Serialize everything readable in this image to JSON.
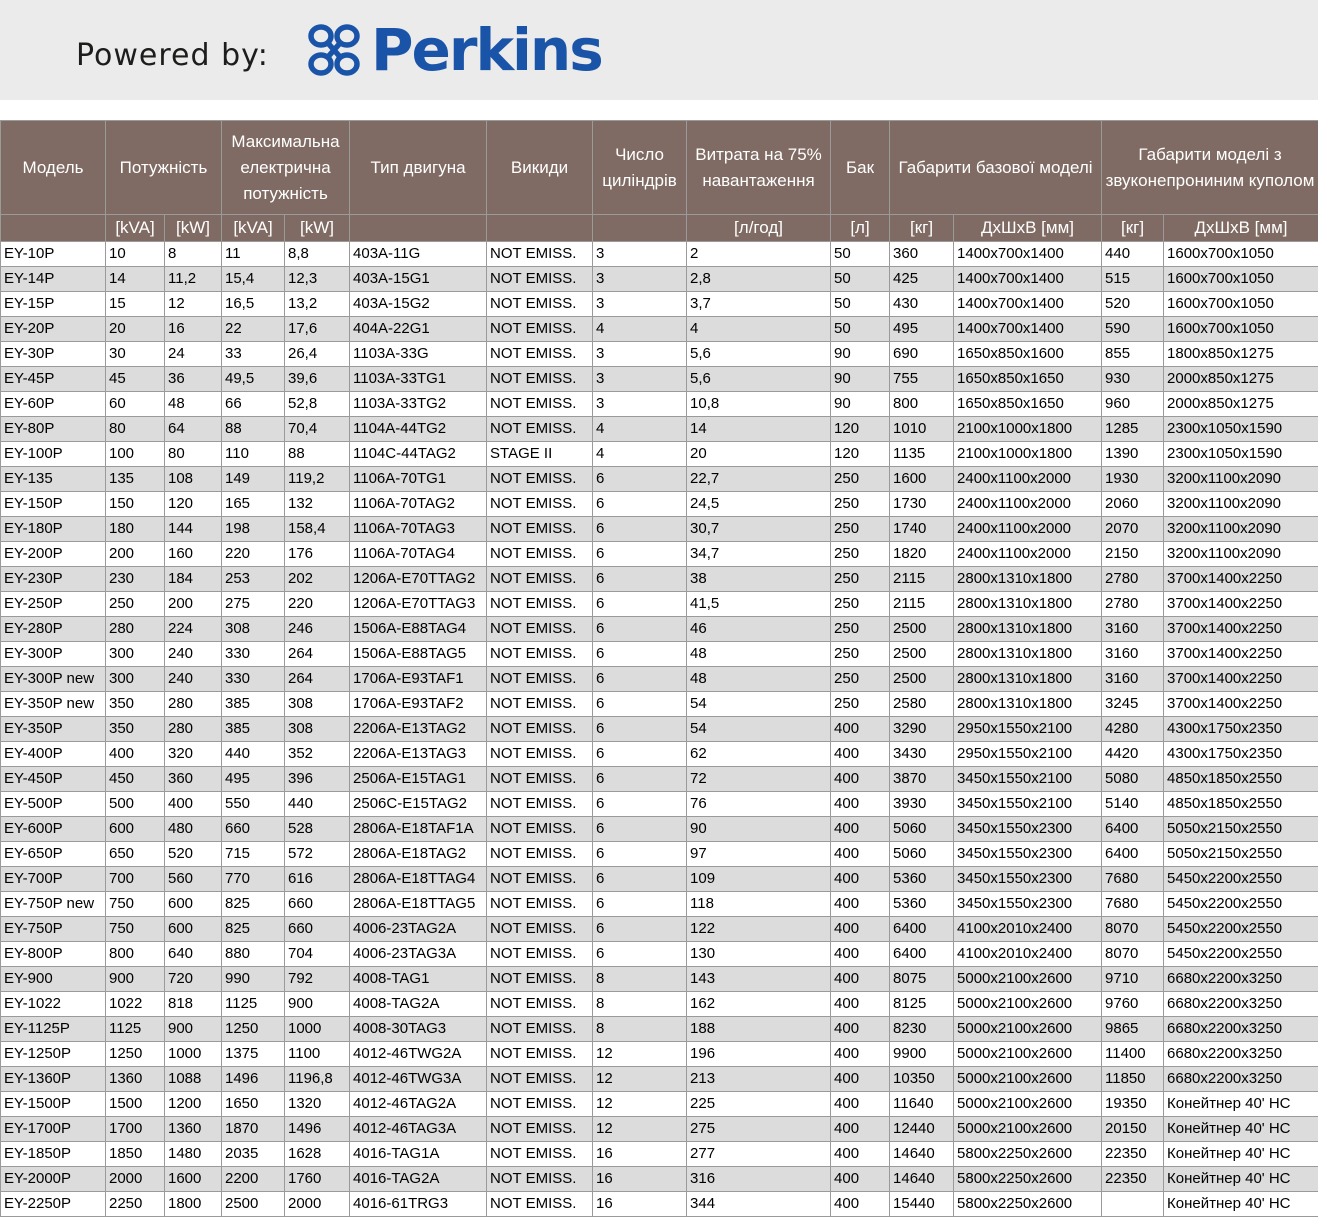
{
  "brand": {
    "powered_by": "Powered by:",
    "logo_text": "Perkins",
    "logo_color": "#1a54a8"
  },
  "header": {
    "model": "Модель",
    "power": "Потужність",
    "max_power": "Максимальна електрична потужність",
    "engine": "Тип двигуна",
    "emissions": "Викиди",
    "cylinders": "Число циліндрів",
    "consumption": "Витрата на 75% навантаження",
    "tank": "Бак",
    "base_dims": "Габарити базової моделі",
    "silent_dims": "Габарити моделі з звуконепрониним куполом"
  },
  "units": {
    "kva": "[kVA]",
    "kw": "[kW]",
    "kva2": "[kVA]",
    "kw2": "[kW]",
    "lph": "[л/год]",
    "l": "[л]",
    "kg": "[кг]",
    "dims": "ДхШхВ [мм]",
    "kg2": "[кг]",
    "dims2": "ДхШхВ [мм]"
  },
  "rows": [
    [
      "EY-10P",
      "10",
      "8",
      "11",
      "8,8",
      "403A-11G",
      "NOT EMISS.",
      "3",
      "2",
      "50",
      "360",
      "1400x700x1400",
      "440",
      "1600x700x1050"
    ],
    [
      "EY-14P",
      "14",
      "11,2",
      "15,4",
      "12,3",
      "403A-15G1",
      "NOT EMISS.",
      "3",
      "2,8",
      "50",
      "425",
      "1400x700x1400",
      "515",
      "1600x700x1050"
    ],
    [
      "EY-15P",
      "15",
      "12",
      "16,5",
      "13,2",
      "403A-15G2",
      "NOT EMISS.",
      "3",
      "3,7",
      "50",
      "430",
      "1400x700x1400",
      "520",
      "1600x700x1050"
    ],
    [
      "EY-20P",
      "20",
      "16",
      "22",
      "17,6",
      "404A-22G1",
      "NOT EMISS.",
      "4",
      "4",
      "50",
      "495",
      "1400x700x1400",
      "590",
      "1600x700x1050"
    ],
    [
      "EY-30P",
      "30",
      "24",
      "33",
      "26,4",
      "1103A-33G",
      "NOT EMISS.",
      "3",
      "5,6",
      "90",
      "690",
      "1650x850x1600",
      "855",
      "1800x850x1275"
    ],
    [
      "EY-45P",
      "45",
      "36",
      "49,5",
      "39,6",
      "1103A-33TG1",
      "NOT EMISS.",
      "3",
      "5,6",
      "90",
      "755",
      "1650x850x1650",
      "930",
      "2000x850x1275"
    ],
    [
      "EY-60P",
      "60",
      "48",
      "66",
      "52,8",
      "1103A-33TG2",
      "NOT EMISS.",
      "3",
      "10,8",
      "90",
      "800",
      "1650x850x1650",
      "960",
      "2000x850x1275"
    ],
    [
      "EY-80P",
      "80",
      "64",
      "88",
      "70,4",
      "1104A-44TG2",
      "NOT EMISS.",
      "4",
      "14",
      "120",
      "1010",
      "2100x1000x1800",
      "1285",
      "2300x1050x1590"
    ],
    [
      "EY-100P",
      "100",
      "80",
      "110",
      "88",
      "1104C-44TAG2",
      "STAGE II",
      "4",
      "20",
      "120",
      "1135",
      "2100x1000x1800",
      "1390",
      "2300x1050x1590"
    ],
    [
      "EY-135",
      "135",
      "108",
      "149",
      "119,2",
      "1106A-70TG1",
      "NOT EMISS.",
      "6",
      "22,7",
      "250",
      "1600",
      "2400x1100x2000",
      "1930",
      "3200x1100x2090"
    ],
    [
      "EY-150P",
      "150",
      "120",
      "165",
      "132",
      "1106A-70TAG2",
      "NOT EMISS.",
      "6",
      "24,5",
      "250",
      "1730",
      "2400x1100x2000",
      "2060",
      "3200x1100x2090"
    ],
    [
      "EY-180P",
      "180",
      "144",
      "198",
      "158,4",
      "1106A-70TAG3",
      "NOT EMISS.",
      "6",
      "30,7",
      "250",
      "1740",
      "2400x1100x2000",
      "2070",
      "3200x1100x2090"
    ],
    [
      "EY-200P",
      "200",
      "160",
      "220",
      "176",
      "1106A-70TAG4",
      "NOT EMISS.",
      "6",
      "34,7",
      "250",
      "1820",
      "2400x1100x2000",
      "2150",
      "3200x1100x2090"
    ],
    [
      "EY-230P",
      "230",
      "184",
      "253",
      "202",
      "1206A-E70TTAG2",
      "NOT EMISS.",
      "6",
      "38",
      "250",
      "2115",
      "2800x1310x1800",
      "2780",
      "3700x1400x2250"
    ],
    [
      "EY-250P",
      "250",
      "200",
      "275",
      "220",
      "1206A-E70TTAG3",
      "NOT EMISS.",
      "6",
      "41,5",
      "250",
      "2115",
      "2800x1310x1800",
      "2780",
      "3700x1400x2250"
    ],
    [
      "EY-280P",
      "280",
      "224",
      "308",
      "246",
      "1506A-E88TAG4",
      "NOT EMISS.",
      "6",
      "46",
      "250",
      "2500",
      "2800x1310x1800",
      "3160",
      "3700x1400x2250"
    ],
    [
      "EY-300P",
      "300",
      "240",
      "330",
      "264",
      "1506A-E88TAG5",
      "NOT EMISS.",
      "6",
      "48",
      "250",
      "2500",
      "2800x1310x1800",
      "3160",
      "3700x1400x2250"
    ],
    [
      "EY-300P new",
      "300",
      "240",
      "330",
      "264",
      "1706A-E93TAF1",
      "NOT EMISS.",
      "6",
      "48",
      "250",
      "2500",
      "2800x1310x1800",
      "3160",
      "3700x1400x2250"
    ],
    [
      "EY-350P new",
      "350",
      "280",
      "385",
      "308",
      "1706A-E93TAF2",
      "NOT EMISS.",
      "6",
      "54",
      "250",
      "2580",
      "2800x1310x1800",
      "3245",
      "3700x1400x2250"
    ],
    [
      "EY-350P",
      "350",
      "280",
      "385",
      "308",
      "2206A-E13TAG2",
      "NOT EMISS.",
      "6",
      "54",
      "400",
      "3290",
      "2950x1550x2100",
      "4280",
      "4300x1750x2350"
    ],
    [
      "EY-400P",
      "400",
      "320",
      "440",
      "352",
      "2206A-E13TAG3",
      "NOT EMISS.",
      "6",
      "62",
      "400",
      "3430",
      "2950x1550x2100",
      "4420",
      "4300x1750x2350"
    ],
    [
      "EY-450P",
      "450",
      "360",
      "495",
      "396",
      "2506A-E15TAG1",
      "NOT EMISS.",
      "6",
      "72",
      "400",
      "3870",
      "3450x1550x2100",
      "5080",
      "4850x1850x2550"
    ],
    [
      "EY-500P",
      "500",
      "400",
      "550",
      "440",
      "2506C-E15TAG2",
      "NOT EMISS.",
      "6",
      "76",
      "400",
      "3930",
      "3450x1550x2100",
      "5140",
      "4850x1850x2550"
    ],
    [
      "EY-600P",
      "600",
      "480",
      "660",
      "528",
      "2806A-E18TAF1A",
      "NOT EMISS.",
      "6",
      "90",
      "400",
      "5060",
      "3450x1550x2300",
      "6400",
      "5050x2150x2550"
    ],
    [
      "EY-650P",
      "650",
      "520",
      "715",
      "572",
      "2806A-E18TAG2",
      "NOT EMISS.",
      "6",
      "97",
      "400",
      "5060",
      "3450x1550x2300",
      "6400",
      "5050x2150x2550"
    ],
    [
      "EY-700P",
      "700",
      "560",
      "770",
      "616",
      "2806A-E18TTAG4",
      "NOT EMISS.",
      "6",
      "109",
      "400",
      "5360",
      "3450x1550x2300",
      "7680",
      "5450x2200x2550"
    ],
    [
      "EY-750P new",
      "750",
      "600",
      "825",
      "660",
      "2806A-E18TTAG5",
      "NOT EMISS.",
      "6",
      "118",
      "400",
      "5360",
      "3450x1550x2300",
      "7680",
      "5450x2200x2550"
    ],
    [
      "EY-750P",
      "750",
      "600",
      "825",
      "660",
      "4006-23TAG2A",
      "NOT EMISS.",
      "6",
      "122",
      "400",
      "6400",
      "4100x2010x2400",
      "8070",
      "5450x2200x2550"
    ],
    [
      "EY-800P",
      "800",
      "640",
      "880",
      "704",
      "4006-23TAG3A",
      "NOT EMISS.",
      "6",
      "130",
      "400",
      "6400",
      "4100x2010x2400",
      "8070",
      "5450x2200x2550"
    ],
    [
      "EY-900",
      "900",
      "720",
      "990",
      "792",
      "4008-TAG1",
      "NOT EMISS.",
      "8",
      "143",
      "400",
      "8075",
      "5000x2100x2600",
      "9710",
      "6680x2200x3250"
    ],
    [
      "EY-1022",
      "1022",
      "818",
      "1125",
      "900",
      "4008-TAG2A",
      "NOT EMISS.",
      "8",
      "162",
      "400",
      "8125",
      "5000x2100x2600",
      "9760",
      "6680x2200x3250"
    ],
    [
      "EY-1125P",
      "1125",
      "900",
      "1250",
      "1000",
      "4008-30TAG3",
      "NOT EMISS.",
      "8",
      "188",
      "400",
      "8230",
      "5000x2100x2600",
      "9865",
      "6680x2200x3250"
    ],
    [
      "EY-1250P",
      "1250",
      "1000",
      "1375",
      "1100",
      "4012-46TWG2A",
      "NOT EMISS.",
      "12",
      "196",
      "400",
      "9900",
      "5000x2100x2600",
      "11400",
      "6680x2200x3250"
    ],
    [
      "EY-1360P",
      "1360",
      "1088",
      "1496",
      "1196,8",
      "4012-46TWG3A",
      "NOT EMISS.",
      "12",
      "213",
      "400",
      "10350",
      "5000x2100x2600",
      "11850",
      "6680x2200x3250"
    ],
    [
      "EY-1500P",
      "1500",
      "1200",
      "1650",
      "1320",
      "4012-46TAG2A",
      "NOT EMISS.",
      "12",
      "225",
      "400",
      "11640",
      "5000x2100x2600",
      "19350",
      "Конейтнер 40' HC"
    ],
    [
      "EY-1700P",
      "1700",
      "1360",
      "1870",
      "1496",
      "4012-46TAG3A",
      "NOT EMISS.",
      "12",
      "275",
      "400",
      "12440",
      "5000x2100x2600",
      "20150",
      "Конейтнер 40' HC"
    ],
    [
      "EY-1850P",
      "1850",
      "1480",
      "2035",
      "1628",
      "4016-TAG1A",
      "NOT EMISS.",
      "16",
      "277",
      "400",
      "14640",
      "5800x2250x2600",
      "22350",
      "Конейтнер 40' HC"
    ],
    [
      "EY-2000P",
      "2000",
      "1600",
      "2200",
      "1760",
      "4016-TAG2A",
      "NOT EMISS.",
      "16",
      "316",
      "400",
      "14640",
      "5800x2250x2600",
      "22350",
      "Конейтнер 40' HC"
    ],
    [
      "EY-2250P",
      "2250",
      "1800",
      "2500",
      "2000",
      "4016-61TRG3",
      "NOT EMISS.",
      "16",
      "344",
      "400",
      "15440",
      "5800x2250x2600",
      "",
      "Конейтнер 40' HC"
    ]
  ]
}
